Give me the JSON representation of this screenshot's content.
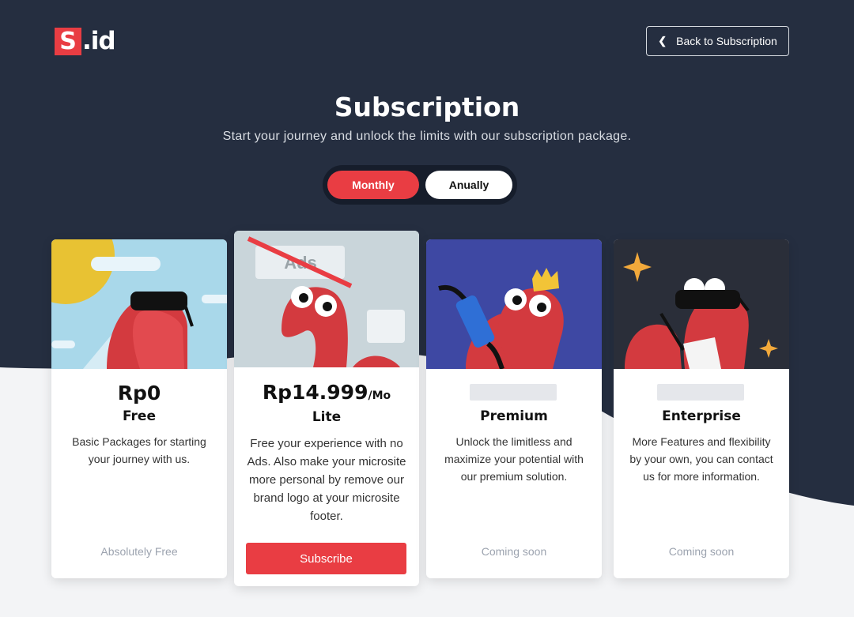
{
  "logo": {
    "mark": "S",
    "rest": ".id"
  },
  "header": {
    "back_label": "Back to Subscription",
    "back_icon": "chevron-left-icon"
  },
  "hero": {
    "title": "Subscription",
    "subtitle": "Start your journey and unlock the limits with our subscription package."
  },
  "billing_toggle": {
    "monthly": "Monthly",
    "annually": "Anually",
    "selected": "Monthly"
  },
  "plans": [
    {
      "price": "Rp0",
      "name": "Free",
      "description": "Basic Packages for starting your journey with us.",
      "footer": "Absolutely Free"
    },
    {
      "price": "Rp14.999",
      "per": "/Mo",
      "name": "Lite",
      "ads_label": "Ads",
      "description": "Free your experience with no Ads. Also make your microsite more personal by remove our brand logo at your microsite footer.",
      "cta": "Subscribe"
    },
    {
      "name": "Premium",
      "description": "Unlock the limitless and maximize your potential with our premium solution.",
      "footer": "Coming soon"
    },
    {
      "name": "Enterprise",
      "description": "More Features and flexibility by your own, you can contact us for more information.",
      "footer": "Coming soon"
    }
  ],
  "colors": {
    "dark_bg": "#252e40",
    "accent": "#e93d43",
    "light_bg": "#f3f4f6"
  }
}
